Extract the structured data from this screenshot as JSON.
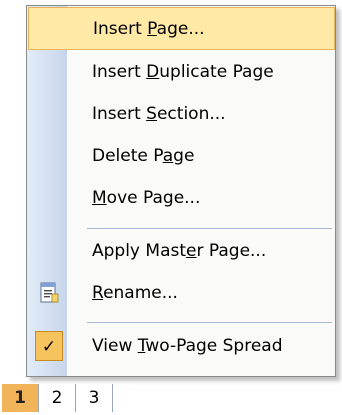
{
  "menu": {
    "items": [
      {
        "label": "Insert Page...",
        "mnemonic": "P",
        "state": "highlighted"
      },
      {
        "label": "Insert Duplicate Page",
        "mnemonic": "D"
      },
      {
        "label": "Insert Section...",
        "mnemonic": "S"
      },
      {
        "label": "Delete Page",
        "mnemonic": "a"
      },
      {
        "label": "Move Page...",
        "mnemonic": "M"
      },
      {
        "label": "Apply Master Page...",
        "mnemonic": "e"
      },
      {
        "label": "Rename...",
        "mnemonic": "R",
        "icon": "rename-page-icon"
      },
      {
        "label": "View Two-Page Spread",
        "mnemonic": "T",
        "checked": true,
        "icon": "checkmark-icon"
      }
    ],
    "check_glyph": "✓"
  },
  "page_tabs": [
    {
      "label": "1",
      "active": true
    },
    {
      "label": "2"
    },
    {
      "label": "3"
    }
  ],
  "colors": {
    "highlight": "#ffe9a6",
    "highlight_border": "#e8b45a",
    "active_tab": "#f2b458",
    "gutter_start": "#e3ecf8",
    "gutter_end": "#c6d5ec"
  }
}
